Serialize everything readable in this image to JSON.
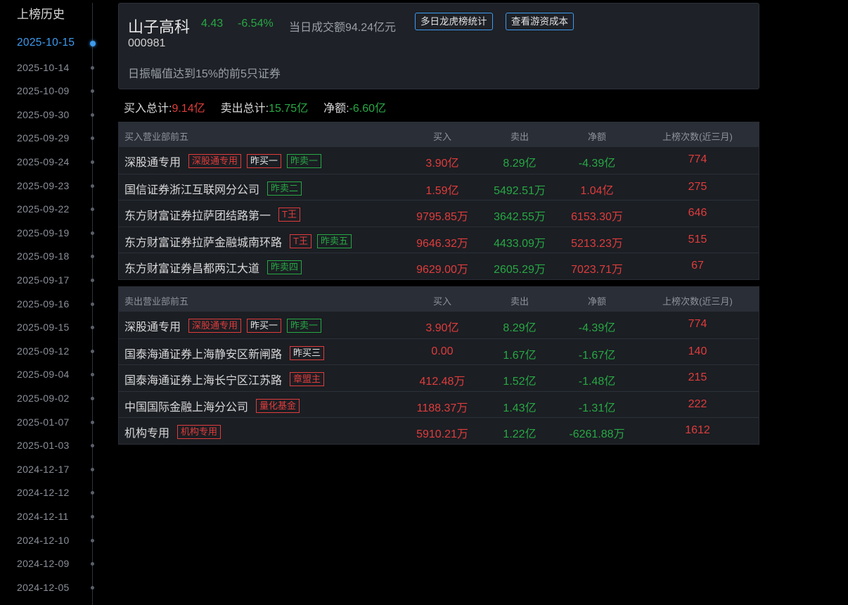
{
  "sidebar": {
    "title": "上榜历史",
    "dates": [
      "2025-10-15",
      "2025-10-14",
      "2025-10-09",
      "2025-09-30",
      "2025-09-29",
      "2025-09-24",
      "2025-09-23",
      "2025-09-22",
      "2025-09-19",
      "2025-09-18",
      "2025-09-17",
      "2025-09-16",
      "2025-09-15",
      "2025-09-12",
      "2025-09-04",
      "2025-09-02",
      "2025-01-07",
      "2025-01-03",
      "2024-12-17",
      "2024-12-12",
      "2024-12-11",
      "2024-12-10",
      "2024-12-09",
      "2024-12-05"
    ],
    "active_index": 0
  },
  "stock": {
    "name": "山子高科",
    "price": "4.43",
    "change": "-6.54%",
    "turnover": "当日成交额94.24亿元",
    "code": "000981",
    "reason": "日振幅值达到15%的前5只证券",
    "btn_multi": "多日龙虎榜统计",
    "btn_cost": "查看游资成本"
  },
  "summary": {
    "buy_label": "买入总计:",
    "buy_value": "9.14亿",
    "sell_label": "卖出总计:",
    "sell_value": "15.75亿",
    "net_label": "净额:",
    "net_value": "-6.60亿"
  },
  "colors": {
    "red": "#e03c3c",
    "green": "#27a844",
    "accent": "#3d9bf0"
  },
  "buy_table": {
    "headers": {
      "title": "买入营业部前五",
      "buy": "买入",
      "sell": "卖出",
      "net": "净额",
      "count": "上榜次数(近三月)"
    },
    "rows": [
      {
        "name": "深股通专用",
        "tags": [
          {
            "text": "深股通专用",
            "style": "tr"
          },
          {
            "text": "昨买一",
            "style": "tw"
          },
          {
            "text": "昨卖一",
            "style": "tg"
          }
        ],
        "buy": "3.90亿",
        "sell": "8.29亿",
        "net": "-4.39亿",
        "net_color": "green",
        "count": "774"
      },
      {
        "name": "国信证券浙江互联网分公司",
        "tags": [
          {
            "text": "昨卖二",
            "style": "tg"
          }
        ],
        "buy": "1.59亿",
        "sell": "5492.51万",
        "net": "1.04亿",
        "net_color": "red",
        "count": "275"
      },
      {
        "name": "东方财富证券拉萨团结路第一",
        "tags": [
          {
            "text": "T王",
            "style": "tr"
          }
        ],
        "buy": "9795.85万",
        "sell": "3642.55万",
        "net": "6153.30万",
        "net_color": "red",
        "count": "646"
      },
      {
        "name": "东方财富证券拉萨金融城南环路",
        "tags": [
          {
            "text": "T王",
            "style": "tr"
          },
          {
            "text": "昨卖五",
            "style": "tg"
          }
        ],
        "buy": "9646.32万",
        "sell": "4433.09万",
        "net": "5213.23万",
        "net_color": "red",
        "count": "515"
      },
      {
        "name": "东方财富证券昌都两江大道",
        "tags": [
          {
            "text": "昨卖四",
            "style": "tg"
          }
        ],
        "buy": "9629.00万",
        "sell": "2605.29万",
        "net": "7023.71万",
        "net_color": "red",
        "count": "67"
      }
    ]
  },
  "sell_table": {
    "headers": {
      "title": "卖出营业部前五",
      "buy": "买入",
      "sell": "卖出",
      "net": "净额",
      "count": "上榜次数(近三月)"
    },
    "rows": [
      {
        "name": "深股通专用",
        "tags": [
          {
            "text": "深股通专用",
            "style": "tr"
          },
          {
            "text": "昨买一",
            "style": "tw"
          },
          {
            "text": "昨卖一",
            "style": "tg"
          }
        ],
        "buy": "3.90亿",
        "sell": "8.29亿",
        "net": "-4.39亿",
        "net_color": "green",
        "count": "774"
      },
      {
        "name": "国泰海通证券上海静安区新闸路",
        "tags": [
          {
            "text": "昨买三",
            "style": "tw"
          }
        ],
        "buy": "0.00",
        "sell": "1.67亿",
        "net": "-1.67亿",
        "net_color": "green",
        "count": "140"
      },
      {
        "name": "国泰海通证券上海长宁区江苏路",
        "tags": [
          {
            "text": "章盟主",
            "style": "tr"
          }
        ],
        "buy": "412.48万",
        "sell": "1.52亿",
        "net": "-1.48亿",
        "net_color": "green",
        "count": "215"
      },
      {
        "name": "中国国际金融上海分公司",
        "tags": [
          {
            "text": "量化基金",
            "style": "tr"
          }
        ],
        "buy": "1188.37万",
        "sell": "1.43亿",
        "net": "-1.31亿",
        "net_color": "green",
        "count": "222"
      },
      {
        "name": "机构专用",
        "tags": [
          {
            "text": "机构专用",
            "style": "tr"
          }
        ],
        "buy": "5910.21万",
        "sell": "1.22亿",
        "net": "-6261.88万",
        "net_color": "green",
        "count": "1612"
      }
    ]
  }
}
